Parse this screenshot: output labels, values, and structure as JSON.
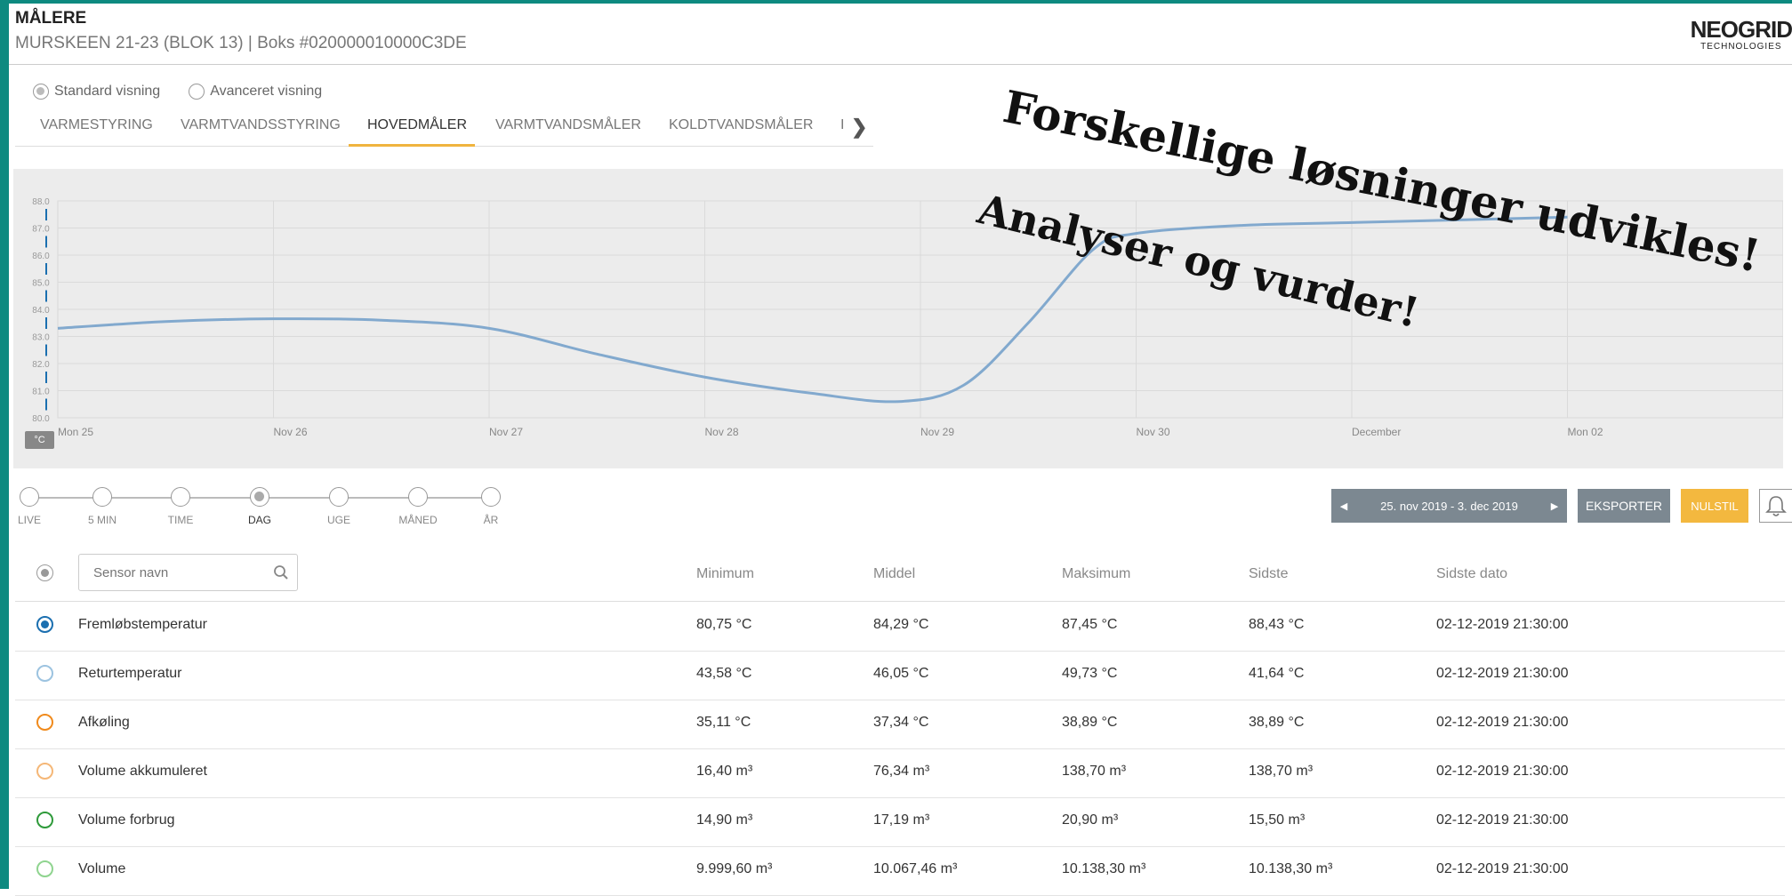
{
  "header": {
    "title": "MÅLERE",
    "subtitle": "MURSKEEN 21-23 (BLOK 13) | Boks #020000010000C3DE",
    "logo_main": "NEOGRID",
    "logo_sub": "TECHNOLOGIES"
  },
  "view_options": [
    {
      "label": "Standard visning",
      "selected": true
    },
    {
      "label": "Avanceret visning",
      "selected": false
    }
  ],
  "tabs": [
    {
      "label": "VARMESTYRING",
      "active": false
    },
    {
      "label": "VARMTVANDSSTYRING",
      "active": false
    },
    {
      "label": "HOVEDMÅLER",
      "active": true
    },
    {
      "label": "VARMTVANDSMÅLER",
      "active": false
    },
    {
      "label": "KOLDTVANDSMÅLER",
      "active": false
    },
    {
      "label": "I",
      "active": false
    }
  ],
  "overlay": {
    "line1": "Forskellige løsninger udvikles!",
    "line2": "Analyser og vurder!"
  },
  "chart_data": {
    "type": "line",
    "title": "",
    "xlabel": "",
    "ylabel": "°C",
    "x_ticks": [
      "Mon 25",
      "Nov 26",
      "Nov 27",
      "Nov 28",
      "Nov 29",
      "Nov 30",
      "December",
      "Mon 02"
    ],
    "y_ticks": [
      "88.0",
      "87.0",
      "86.0",
      "85.0",
      "84.0",
      "83.0",
      "82.0",
      "81.0",
      "80.0"
    ],
    "ylim": [
      80,
      88
    ],
    "xlim": [
      0,
      8
    ],
    "grid": true,
    "line_color": "#82a9ce",
    "series": [
      {
        "x": [
          0,
          0.5,
          1,
          1.5,
          2,
          2.5,
          3,
          3.5,
          3.9,
          4.2,
          4.5,
          4.8,
          5,
          5.5,
          6,
          6.5,
          7
        ],
        "y": [
          83.3,
          83.55,
          83.65,
          83.6,
          83.3,
          82.35,
          81.5,
          80.9,
          80.6,
          81.2,
          83.5,
          86.2,
          86.8,
          87.1,
          87.2,
          87.3,
          87.4
        ]
      }
    ]
  },
  "time_range": {
    "options": [
      "LIVE",
      "5 MIN",
      "TIME",
      "DAG",
      "UGE",
      "MÅNED",
      "ÅR"
    ],
    "selected": "DAG"
  },
  "date_range": "25. nov 2019 - 3. dec 2019",
  "buttons": {
    "export": "EKSPORTER",
    "reset": "NULSTIL"
  },
  "table": {
    "search_placeholder": "Sensor navn",
    "columns": [
      "Minimum",
      "Middel",
      "Maksimum",
      "Sidste",
      "Sidste dato"
    ],
    "rows": [
      {
        "name": "Fremløbstemperatur",
        "color": "#1b6fb0",
        "selected": true,
        "min": "80,75 °C",
        "avg": "84,29 °C",
        "max": "87,45 °C",
        "last": "88,43 °C",
        "date": "02-12-2019 21:30:00"
      },
      {
        "name": "Returtemperatur",
        "color": "#9cc3e0",
        "selected": false,
        "min": "43,58 °C",
        "avg": "46,05 °C",
        "max": "49,73 °C",
        "last": "41,64 °C",
        "date": "02-12-2019 21:30:00"
      },
      {
        "name": "Afkøling",
        "color": "#f08a1c",
        "selected": false,
        "min": "35,11 °C",
        "avg": "37,34 °C",
        "max": "38,89 °C",
        "last": "38,89 °C",
        "date": "02-12-2019 21:30:00"
      },
      {
        "name": "Volume akkumuleret",
        "color": "#f5b777",
        "selected": false,
        "min": "16,40 m³",
        "avg": "76,34 m³",
        "max": "138,70 m³",
        "last": "138,70 m³",
        "date": "02-12-2019 21:30:00"
      },
      {
        "name": "Volume forbrug",
        "color": "#2e9a3a",
        "selected": false,
        "min": "14,90 m³",
        "avg": "17,19 m³",
        "max": "20,90 m³",
        "last": "15,50 m³",
        "date": "02-12-2019 21:30:00"
      },
      {
        "name": "Volume",
        "color": "#8fd48f",
        "selected": false,
        "min": "9.999,60 m³",
        "avg": "10.067,46 m³",
        "max": "10.138,30 m³",
        "last": "10.138,30 m³",
        "date": "02-12-2019 21:30:00"
      }
    ]
  }
}
